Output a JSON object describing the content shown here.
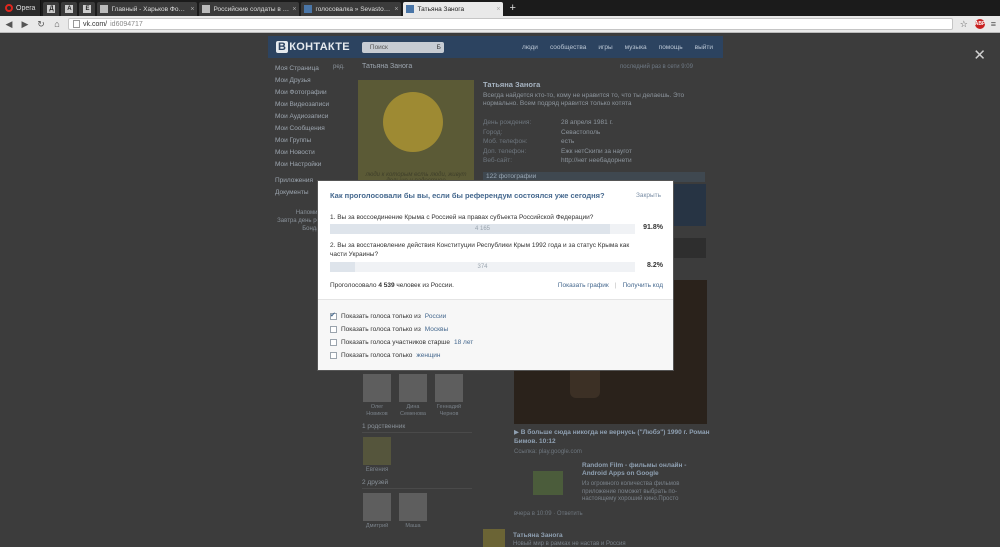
{
  "browser": {
    "opera_label": "Opera",
    "mini_tabs": [
      "Д",
      "A",
      "E"
    ],
    "tabs": [
      {
        "title": "Главный - Харьков Форум",
        "fav": "plain"
      },
      {
        "title": "Российские солдаты в Кр",
        "fav": "plain"
      },
      {
        "title": "голосовалка » Sevastopol",
        "fav": "vk"
      },
      {
        "title": "Татьяна Занога",
        "fav": "vk",
        "active": true
      }
    ],
    "new_tab": "+",
    "url_host": "vk.com/",
    "url_path": "id6094717",
    "abp": "ABP"
  },
  "vk": {
    "logo_box": "В",
    "logo_text": "КОНТАКТЕ",
    "search_placeholder": "Поиск",
    "nav": [
      "люди",
      "сообщества",
      "игры",
      "музыка",
      "помощь",
      "выйти"
    ],
    "left_menu": [
      "Моя Страница",
      "Мои Друзья",
      "Мои Фотографии",
      "Мои Видеозаписи",
      "Мои Аудиозаписи",
      "Мои Сообщения",
      "Мои Группы",
      "Мои Новости",
      "Мои Настройки"
    ],
    "left_menu_extra": [
      "Приложения",
      "Документы"
    ],
    "edit_label": "ред.",
    "reminder_title": "Напоминание",
    "reminder_text": "Завтра день рождения Ж.и Бондарь.",
    "profile_top": "Татьяна Занога",
    "status_top": "последний раз в сети 9:09",
    "avatar_text": "люди к которым есть люди, живут дольше и радостнее",
    "name": "Татьяна Занога",
    "status": "Всегда найдется кто-то, кому не нравится то, что ты делаешь. Это нормально. Всем подряд нравится только котята",
    "info": [
      {
        "k": "День рождения:",
        "v": "28 апреля 1981 г."
      },
      {
        "k": "Город:",
        "v": "Севастополь"
      },
      {
        "k": "Моб. телефон:",
        "v": "есть"
      },
      {
        "k": "Доп. телефон:",
        "v": "Ежк нетСкипи за наугот"
      },
      {
        "k": "Веб-сайт:",
        "v": "http://нет неебадорнети"
      }
    ],
    "photos_head": "122 фотографии",
    "music": "▶ В больше сюда никогда не вернусь (\"Любэ\") 1990 г. Роман Бимов. 10:12",
    "music_src": "Ссылка: play.google.com",
    "post_title": "Random Film - фильмы онлайн - Android Apps on Google",
    "post_desc": "Из огромного количества фильмов приложение поможет выбрать по-настоящему хороший кино.Просто",
    "post_time": "вчера в 10:09  ·  Ответить",
    "post_author": "Татьяна Занога",
    "post_body": "Новый мир в рамках не настав и Россия",
    "friends": [
      "Олег Новиков",
      "Дина Семенова",
      "Геннадий Чернов"
    ],
    "relatives_label": "1 родственник",
    "relative": "Евгения",
    "relatives2_label": "2 друзей",
    "friends2": [
      "Дмитрий",
      "Маша"
    ]
  },
  "poll": {
    "title": "Как проголосовали бы вы, если бы референдум состоялся уже сегодня?",
    "close_label": "Закрыть",
    "questions": [
      {
        "text": "1. Вы за воссоединение Крыма с Россией на правах субъекта Российской Федерации?",
        "count": "4 165",
        "pct": "91.8%",
        "share": 0.918
      },
      {
        "text": "2. Вы за восстановление действия Конституции Республики Крым 1992 года и за статус Крыма как части Украины?",
        "count": "374",
        "pct": "8.2%",
        "share": 0.082
      }
    ],
    "voted_pre": "Проголосовало",
    "voted_num": "4 539",
    "voted_post": "человек из России.",
    "show_graph": "Показать график",
    "sep": "|",
    "get_code": "Получить код",
    "filters": [
      {
        "pre": "Показать голоса только из ",
        "hl": "России",
        "checked": true
      },
      {
        "pre": "Показать голоса только из ",
        "hl": "Москвы",
        "checked": false
      },
      {
        "pre": "Показать голоса участников старше ",
        "hl": "18 лет",
        "checked": false
      },
      {
        "pre": "Показать голоса только ",
        "hl": "женщин",
        "checked": false
      }
    ]
  }
}
